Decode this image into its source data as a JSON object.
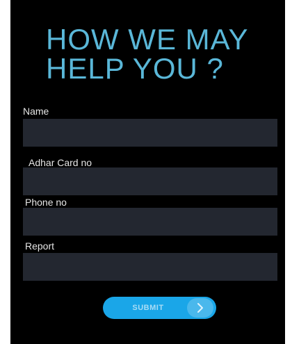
{
  "form": {
    "title_line1": "HOW WE MAY",
    "title_line2": "HELP YOU ?",
    "fields": [
      {
        "label": "Name",
        "value": ""
      },
      {
        "label": "Adhar Card no",
        "value": ""
      },
      {
        "label": "Phone no",
        "value": ""
      },
      {
        "label": "Report",
        "value": ""
      }
    ],
    "submit_label": "SUBMIT",
    "submit_icon": "chevron-right-icon"
  },
  "colors": {
    "background": "#000000",
    "title": "#5ab7d8",
    "input_background": "#232730",
    "label_text": "#e6e6e6",
    "button": "#1aa6e8"
  }
}
